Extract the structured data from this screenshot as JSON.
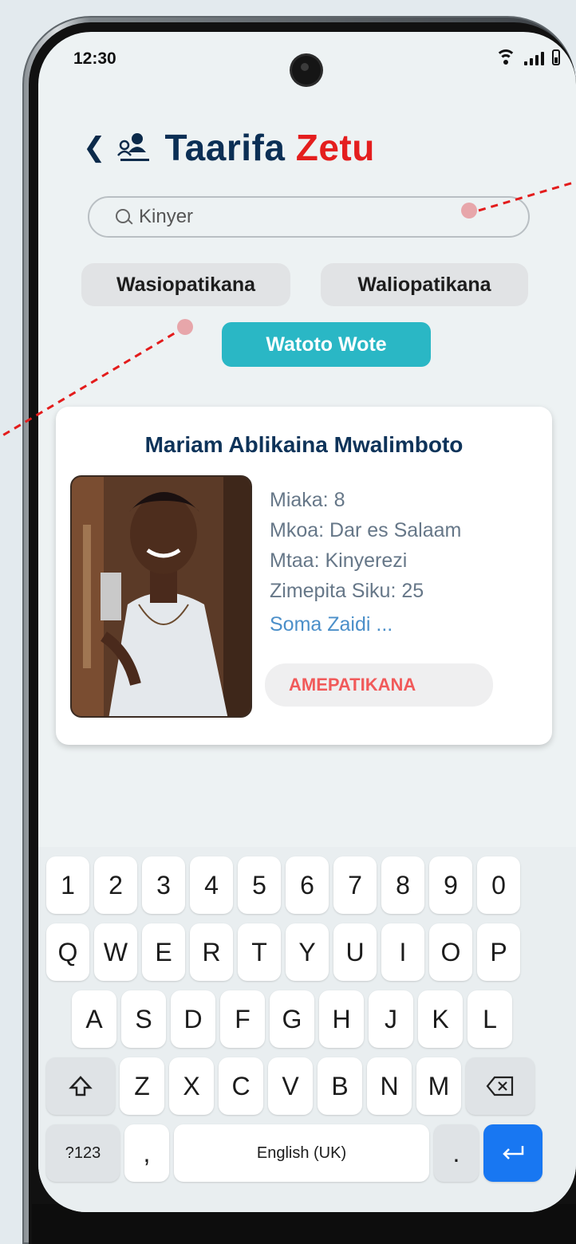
{
  "status_bar": {
    "time": "12:30"
  },
  "header": {
    "title_part1": "Taarifa",
    "title_part2": "Zetu"
  },
  "search": {
    "value": "Kinyer"
  },
  "filters": {
    "missing": "Wasiopatikana",
    "found": "Waliopatikana",
    "all": "Watoto Wote"
  },
  "card": {
    "name": "Mariam Ablikaina Mwalimboto",
    "age": "Miaka: 8",
    "region": "Mkoa: Dar es Salaam",
    "street": "Mtaa: Kinyerezi",
    "days": "Zimepita Siku: 25",
    "more": "Soma Zaidi ...",
    "status": "AMEPATIKANA"
  },
  "keyboard": {
    "row1": [
      "1",
      "2",
      "3",
      "4",
      "5",
      "6",
      "7",
      "8",
      "9",
      "0"
    ],
    "row2": [
      "Q",
      "W",
      "E",
      "R",
      "T",
      "Y",
      "U",
      "I",
      "O",
      "P"
    ],
    "row3": [
      "A",
      "S",
      "D",
      "F",
      "G",
      "H",
      "J",
      "K",
      "L"
    ],
    "row4": [
      "Z",
      "X",
      "C",
      "V",
      "B",
      "N",
      "M"
    ],
    "symbols": "?123",
    "comma": ",",
    "space": "English (UK)",
    "period": "."
  },
  "colors": {
    "title_blue": "#0b2f55",
    "title_red": "#e41e1e",
    "accent_teal": "#2ab7c5",
    "status_red": "#f15a5a",
    "enter_blue": "#1877f2"
  }
}
